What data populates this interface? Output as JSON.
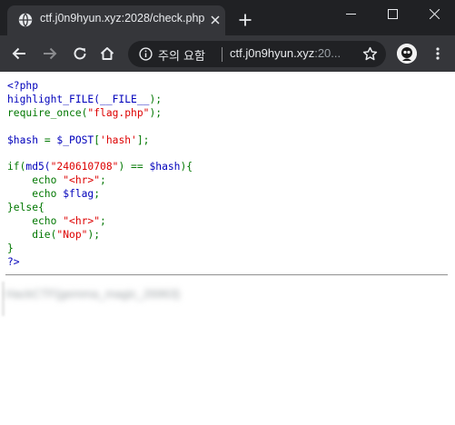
{
  "browser": {
    "tab": {
      "title": "ctf.j0n9hyun.xyz:2028/check.php"
    },
    "address_bar": {
      "security_label": "주의 요함",
      "url_host": "ctf.j0n9hyun.xyz",
      "url_rest": ":20..."
    },
    "icons": {
      "favicon": "globe-icon",
      "tab_close": "close-icon",
      "new_tab": "plus-icon",
      "back": "arrow-left-icon",
      "forward": "arrow-right-icon",
      "reload": "reload-icon",
      "home": "home-icon",
      "info": "info-icon",
      "bookmark": "star-icon",
      "profile": "avatar",
      "menu": "kebab-menu-icon"
    },
    "colors": {
      "titlebar": "#202124",
      "toolbar": "#35363a",
      "omnibox": "#202124",
      "text": "#e8eaed"
    }
  },
  "page": {
    "code_lines": [
      [
        {
          "t": "<?php",
          "c": "def"
        }
      ],
      [
        {
          "t": "highlight_FILE(",
          "c": "def"
        },
        {
          "t": "__FILE__",
          "c": "def"
        },
        {
          "t": ");",
          "c": "kw"
        }
      ],
      [
        {
          "t": "require_once(",
          "c": "kw"
        },
        {
          "t": "\"flag.php\"",
          "c": "str"
        },
        {
          "t": ");",
          "c": "kw"
        }
      ],
      [],
      [
        {
          "t": "$hash ",
          "c": "def"
        },
        {
          "t": "= ",
          "c": "kw"
        },
        {
          "t": "$_POST",
          "c": "def"
        },
        {
          "t": "[",
          "c": "kw"
        },
        {
          "t": "'hash'",
          "c": "str"
        },
        {
          "t": "];",
          "c": "kw"
        }
      ],
      [],
      [
        {
          "t": "if(",
          "c": "kw"
        },
        {
          "t": "md5(",
          "c": "def"
        },
        {
          "t": "\"240610708\"",
          "c": "str"
        },
        {
          "t": ") == ",
          "c": "kw"
        },
        {
          "t": "$hash",
          "c": "def"
        },
        {
          "t": "){",
          "c": "kw"
        }
      ],
      [
        {
          "t": "    echo ",
          "c": "kw"
        },
        {
          "t": "\"<hr>\"",
          "c": "str"
        },
        {
          "t": ";",
          "c": "kw"
        }
      ],
      [
        {
          "t": "    echo ",
          "c": "kw"
        },
        {
          "t": "$flag",
          "c": "def"
        },
        {
          "t": ";",
          "c": "kw"
        }
      ],
      [
        {
          "t": "}else{",
          "c": "kw"
        }
      ],
      [
        {
          "t": "    echo ",
          "c": "kw"
        },
        {
          "t": "\"<hr>\"",
          "c": "str"
        },
        {
          "t": ";",
          "c": "kw"
        }
      ],
      [
        {
          "t": "    die(",
          "c": "kw"
        },
        {
          "t": "\"Nop\"",
          "c": "str"
        },
        {
          "t": ");",
          "c": "kw"
        }
      ],
      [
        {
          "t": "}",
          "c": "kw"
        }
      ],
      [
        {
          "t": "?>",
          "c": "def"
        }
      ]
    ],
    "flag_output": "HackCTF{gemma_magic_26963}",
    "syntax_colors": {
      "kw": "#007700",
      "def": "#0000bb",
      "str": "#dd0000"
    }
  }
}
